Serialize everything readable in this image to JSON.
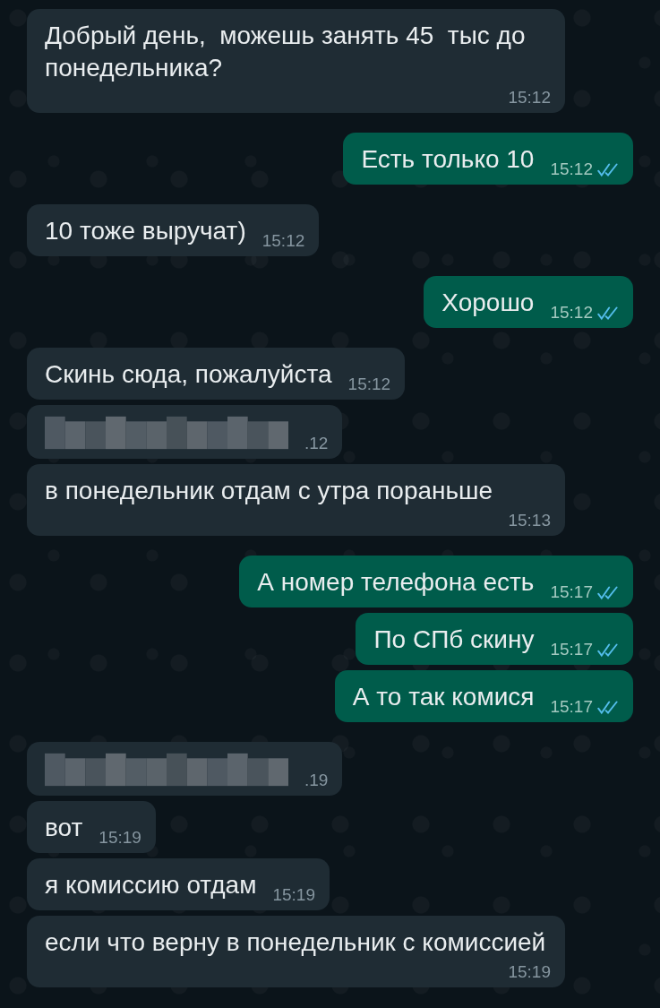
{
  "messages": [
    {
      "kind": "text",
      "outgoing": false,
      "text": "Добрый день,  можешь занять 45  тыс до понедельника?",
      "time": "15:12"
    },
    {
      "kind": "text",
      "outgoing": true,
      "text": "Есть только 10",
      "time": "15:12",
      "read": true
    },
    {
      "kind": "text",
      "outgoing": false,
      "text": "10 тоже выручат)",
      "time": "15:12"
    },
    {
      "kind": "text",
      "outgoing": true,
      "text": "Хорошо",
      "time": "15:12",
      "read": true
    },
    {
      "kind": "text",
      "outgoing": false,
      "text": "Скинь сюда, пожалуйста",
      "time": "15:12"
    },
    {
      "kind": "redacted",
      "outgoing": false,
      "time": ".12"
    },
    {
      "kind": "text",
      "outgoing": false,
      "text": "в понедельник отдам с утра пораньше",
      "time": "15:13"
    },
    {
      "kind": "text",
      "outgoing": true,
      "text": "А номер телефона есть",
      "time": "15:17",
      "read": true
    },
    {
      "kind": "text",
      "outgoing": true,
      "text": "По СПб скину",
      "time": "15:17",
      "read": true
    },
    {
      "kind": "text",
      "outgoing": true,
      "text": "А то так комися",
      "time": "15:17",
      "read": true
    },
    {
      "kind": "redacted",
      "outgoing": false,
      "time": ".19"
    },
    {
      "kind": "text",
      "outgoing": false,
      "text": "вот",
      "time": "15:19"
    },
    {
      "kind": "text",
      "outgoing": false,
      "text": "я комиссию отдам",
      "time": "15:19"
    },
    {
      "kind": "text",
      "outgoing": false,
      "text": "если что верну в понедельник с комиссией",
      "time": "15:19"
    }
  ]
}
